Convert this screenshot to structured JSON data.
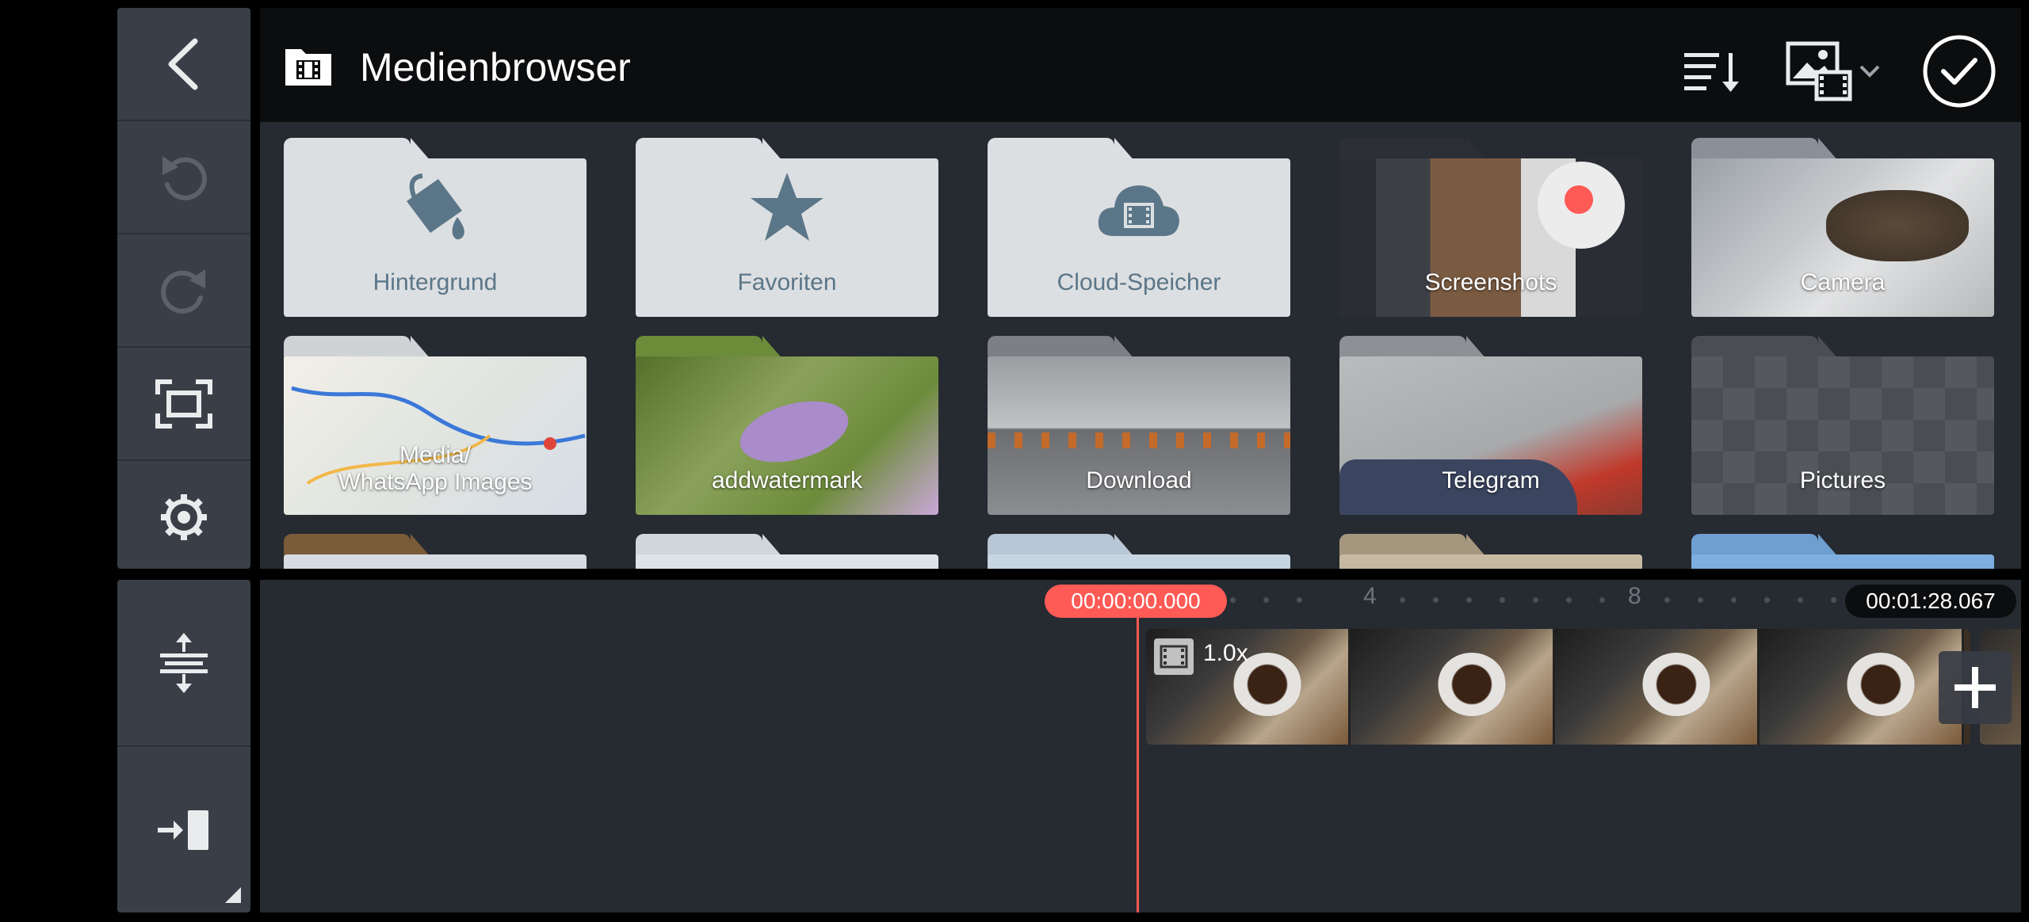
{
  "header": {
    "title": "Medienbrowser",
    "folder_icon": "film-folder-icon",
    "sort_icon": "sort-list-icon",
    "media_type_icon": "image-video-icon",
    "confirm_icon": "checkmark-circle-icon"
  },
  "rail_top": [
    "back-icon",
    "undo-icon",
    "redo-icon",
    "fullscreen-icon",
    "settings-icon"
  ],
  "rail_bottom": [
    "track-height-icon",
    "jump-to-end-icon"
  ],
  "folders": [
    {
      "label": "Hintergrund",
      "style": "light",
      "icon": "paint-bucket-icon"
    },
    {
      "label": "Favoriten",
      "style": "light",
      "icon": "star-icon"
    },
    {
      "label": "Cloud-Speicher",
      "style": "light",
      "icon": "cloud-icon"
    },
    {
      "label": "Screenshots",
      "style": "photo"
    },
    {
      "label": "Camera",
      "style": "photo"
    },
    {
      "label": "Media/\nWhatsApp Images",
      "style": "photo"
    },
    {
      "label": "addwatermark",
      "style": "photo"
    },
    {
      "label": "Download",
      "style": "photo"
    },
    {
      "label": "Telegram",
      "style": "photo"
    },
    {
      "label": "Pictures",
      "style": "photo"
    }
  ],
  "timeline": {
    "playhead_time": "00:00:00.000",
    "total_duration": "00:01:28.067",
    "ruler_marks": [
      "4",
      "8"
    ],
    "clip_speed": "1.0x",
    "add_icon": "plus-icon"
  },
  "colors": {
    "accent": "#ff5a55",
    "panel": "#262a31",
    "rail": "#3a3f47",
    "folder_light": "#dcdfe2",
    "folder_label": "#5b7688"
  }
}
